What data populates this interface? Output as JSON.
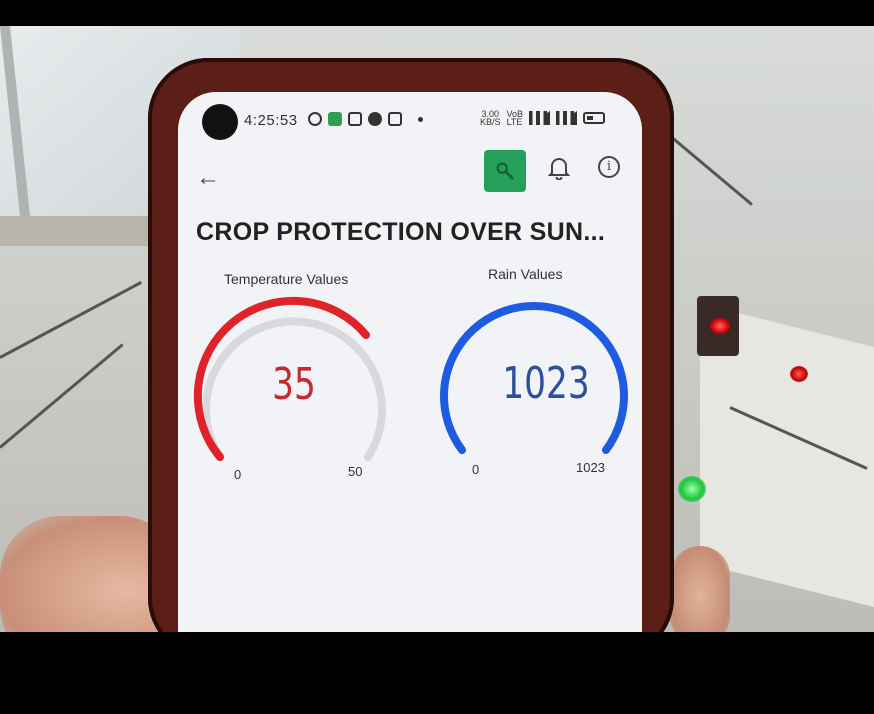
{
  "status_bar": {
    "time": "4:25:53",
    "network_speed": "3.00",
    "network_speed_unit": "KB/S",
    "volte": "VoB LTE",
    "signal": "4G"
  },
  "app_bar": {
    "back_icon": "arrow-left-icon",
    "action_icon": "wrench-icon",
    "bell_icon": "bell-icon",
    "info_icon": "info-icon"
  },
  "page_title": "CROP PROTECTION  OVER SUN...",
  "gauges": {
    "temperature": {
      "label": "Temperature Values",
      "value": "35",
      "min": "0",
      "max": "50",
      "color": "#e0232b"
    },
    "rain": {
      "label": "Rain Values",
      "value": "1023",
      "min": "0",
      "max": "1023",
      "color": "#1f5be0"
    }
  }
}
